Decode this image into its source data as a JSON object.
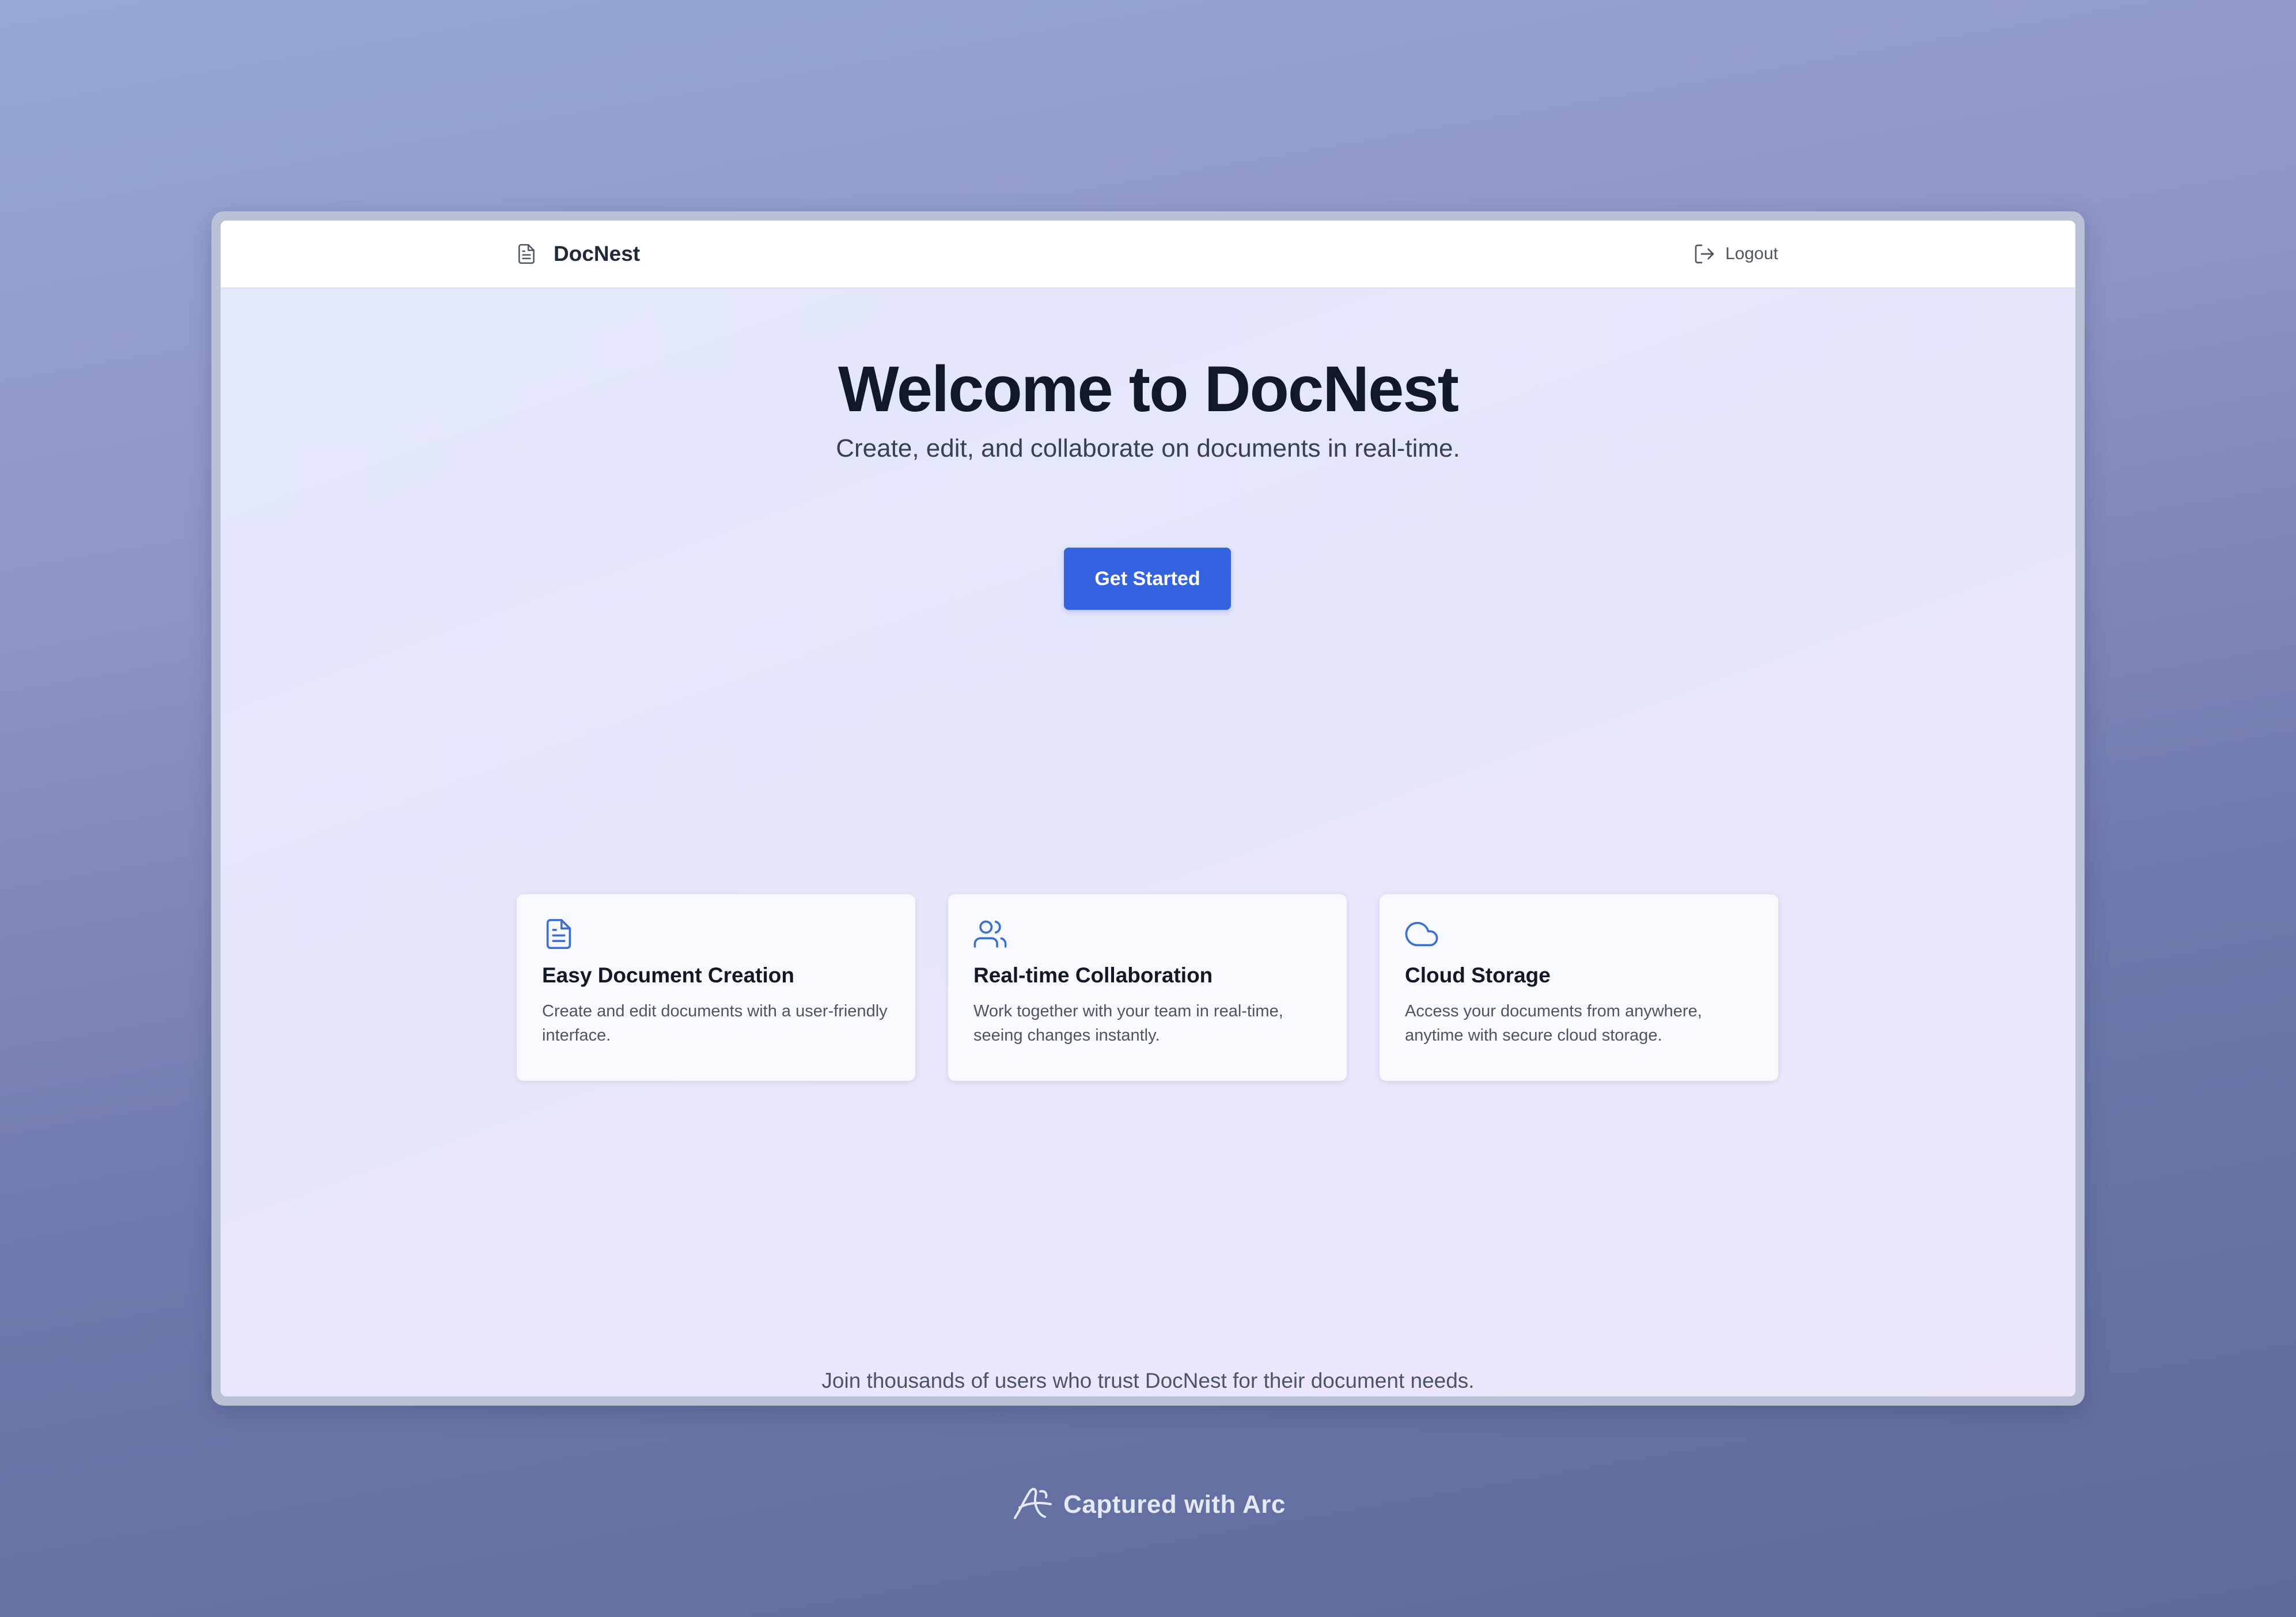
{
  "app": {
    "brand_name": "DocNest",
    "brand_icon": "file-text-icon",
    "logout_label": "Logout",
    "logout_icon": "log-out-icon"
  },
  "hero": {
    "title": "Welcome to DocNest",
    "subtitle": "Create, edit, and collaborate on documents in real-time.",
    "cta_label": "Get Started"
  },
  "features": [
    {
      "icon": "file-text-icon",
      "title": "Easy Document Creation",
      "description": "Create and edit documents with a user-friendly interface."
    },
    {
      "icon": "users-icon",
      "title": "Real-time Collaboration",
      "description": "Work together with your team in real-time, seeing changes instantly."
    },
    {
      "icon": "cloud-icon",
      "title": "Cloud Storage",
      "description": "Access your documents from anywhere, anytime with secure cloud storage."
    }
  ],
  "footer": {
    "text": "Join thousands of users who trust DocNest for their document needs."
  },
  "capture": {
    "label": "Captured with Arc",
    "icon": "arc-logo-icon"
  },
  "colors": {
    "accent": "#3563e0",
    "icon_blue": "#3b6fd8",
    "title_text": "#111827",
    "body_text": "#4b5563"
  }
}
